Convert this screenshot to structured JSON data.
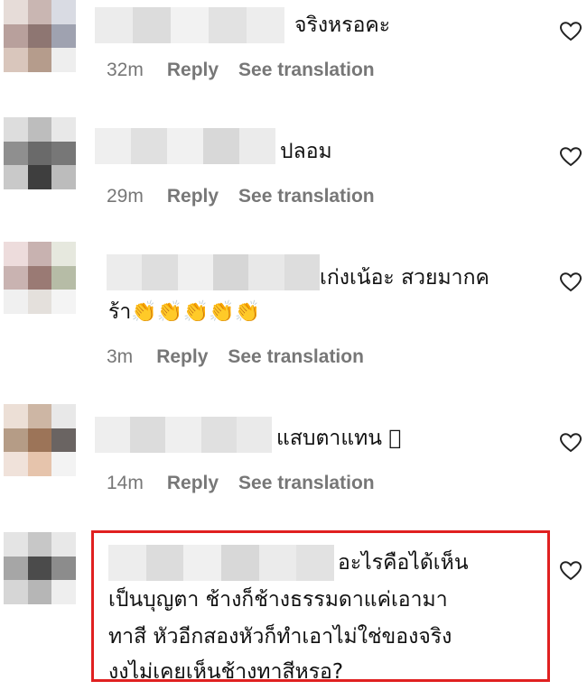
{
  "comments": [
    {
      "text_lines": [
        "จริงหรอคะ"
      ],
      "time": "32m",
      "reply": "Reply",
      "translate": "See translation"
    },
    {
      "text_lines": [
        "ปลอม"
      ],
      "time": "29m",
      "reply": "Reply",
      "translate": "See translation"
    },
    {
      "text_lines": [
        "เก่งเน้อะ สวยมากค",
        "ร้า👏👏👏👏👏"
      ],
      "time": "3m",
      "reply": "Reply",
      "translate": "See translation"
    },
    {
      "text_lines": [
        "แสบตาแทน ⃞"
      ],
      "time": "14m",
      "reply": "Reply",
      "translate": "See translation"
    },
    {
      "text_lines": [
        "อะไรคือได้เห็น",
        "เป็นบุญตา ช้างก็ช้างธรรมดาแค่เอามา",
        "ทาสี หัวอีกสองหัวก็ทำเอาไม่ใช่ของจริง",
        "งงไม่เคยเห็นช้างทาสีหรอ?"
      ]
    }
  ],
  "icons": {
    "like": "heart-outline-icon",
    "avatar": "pixelated-avatar",
    "name": "pixelated-username"
  },
  "colors": {
    "meta_text": "#777777",
    "highlight_border": "#e02020",
    "heart_stroke": "#222222"
  }
}
